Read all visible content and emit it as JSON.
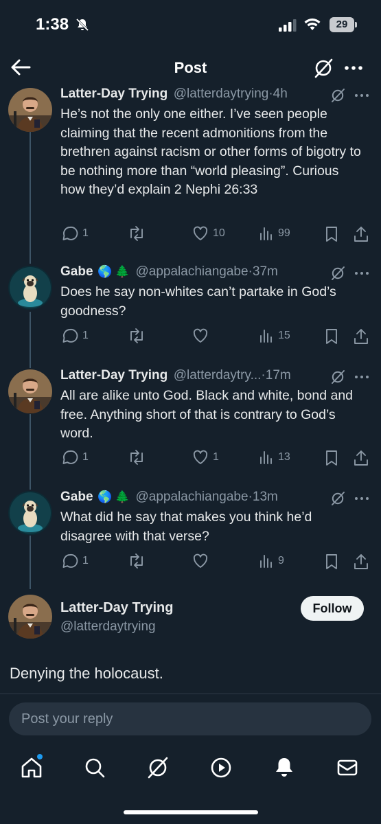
{
  "status_bar": {
    "time": "1:38",
    "battery": "29"
  },
  "header": {
    "title": "Post"
  },
  "thread": [
    {
      "name": "Latter-Day Trying",
      "emoji": "",
      "handle": "@latterdaytrying",
      "time": "4h",
      "text": "He’s not the only one either. I’ve seen people claiming that the recent admonitions from the brethren against racism or other forms of bigotry to be nothing more than “world pleasing”. Curious how they’d explain 2 Nephi 26:33",
      "replies": "1",
      "reposts": "",
      "likes": "10",
      "views": "99"
    },
    {
      "name": "Gabe",
      "emoji": "🌎 🌲",
      "handle": "@appalachiangabe",
      "time": "37m",
      "text": "Does he say non-whites can’t partake in God’s goodness?",
      "replies": "1",
      "reposts": "",
      "likes": "",
      "views": "15"
    },
    {
      "name": "Latter-Day Trying",
      "emoji": "",
      "handle": "@latterdaytry...",
      "time": "17m",
      "text": "All are alike unto God. Black and white, bond and free. Anything short of that is contrary to God’s word.",
      "replies": "1",
      "reposts": "",
      "likes": "1",
      "views": "13"
    },
    {
      "name": "Gabe",
      "emoji": "🌎 🌲",
      "handle": "@appalachiangabe",
      "time": "13m",
      "text": "What did he say that makes you think he’d disagree with that verse?",
      "replies": "1",
      "reposts": "",
      "likes": "",
      "views": "9"
    }
  ],
  "main_post": {
    "name": "Latter-Day Trying",
    "handle": "@latterdaytrying",
    "follow_label": "Follow",
    "text": "Denying the holocaust."
  },
  "reply": {
    "placeholder": "Post your reply"
  },
  "tabbar": [
    "home-icon",
    "search-icon",
    "grok-icon",
    "video-icon",
    "notifications-icon",
    "messages-icon"
  ],
  "colors": {
    "background": "#15202b",
    "accent": "#1d9bf0",
    "muted": "#8b98a5"
  }
}
